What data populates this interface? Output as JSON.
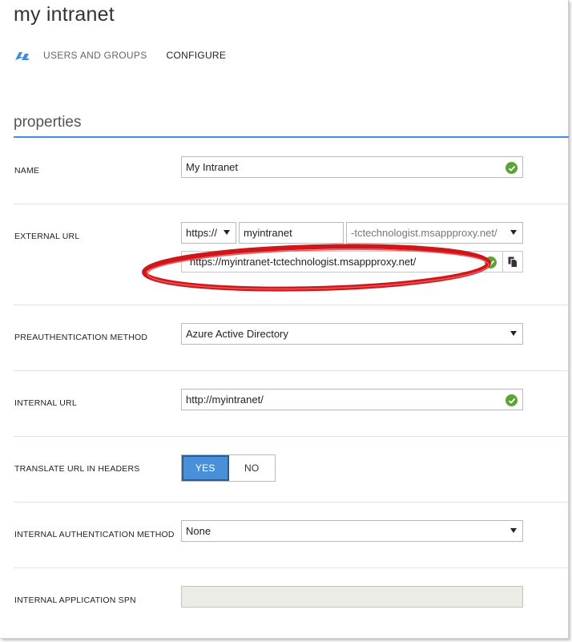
{
  "header": {
    "app_title": "my intranet"
  },
  "nav": {
    "icon": "quick-start-icon",
    "items": [
      {
        "label": "USERS AND GROUPS"
      },
      {
        "label": "CONFIGURE"
      }
    ]
  },
  "section": {
    "title": "properties",
    "accent_color": "#3f8ede"
  },
  "fields": {
    "name": {
      "label": "NAME",
      "value": "My Intranet",
      "valid": true
    },
    "external_url": {
      "label": "EXTERNAL URL",
      "scheme": "https://",
      "subdomain": "myintranet",
      "domain": "-tctechnologist.msappproxy.net/",
      "full_url": "https://myintranet-tctechnologist.msappproxy.net/",
      "valid": true
    },
    "preauthentication_method": {
      "label": "PREAUTHENTICATION METHOD",
      "value": "Azure Active Directory"
    },
    "internal_url": {
      "label": "INTERNAL URL",
      "value": "http://myintranet/",
      "valid": true
    },
    "translate_url": {
      "label": "TRANSLATE URL IN HEADERS",
      "yes_label": "YES",
      "no_label": "NO",
      "selected": "YES",
      "selected_color": "#4a90d9"
    },
    "internal_auth_method": {
      "label": "INTERNAL AUTHENTICATION METHOD",
      "value": "None"
    },
    "internal_app_spn": {
      "label": "INTERNAL APPLICATION SPN",
      "value": ""
    }
  },
  "colors": {
    "valid_check": "#5aa532",
    "annotation_ellipse": "#d0161b"
  }
}
